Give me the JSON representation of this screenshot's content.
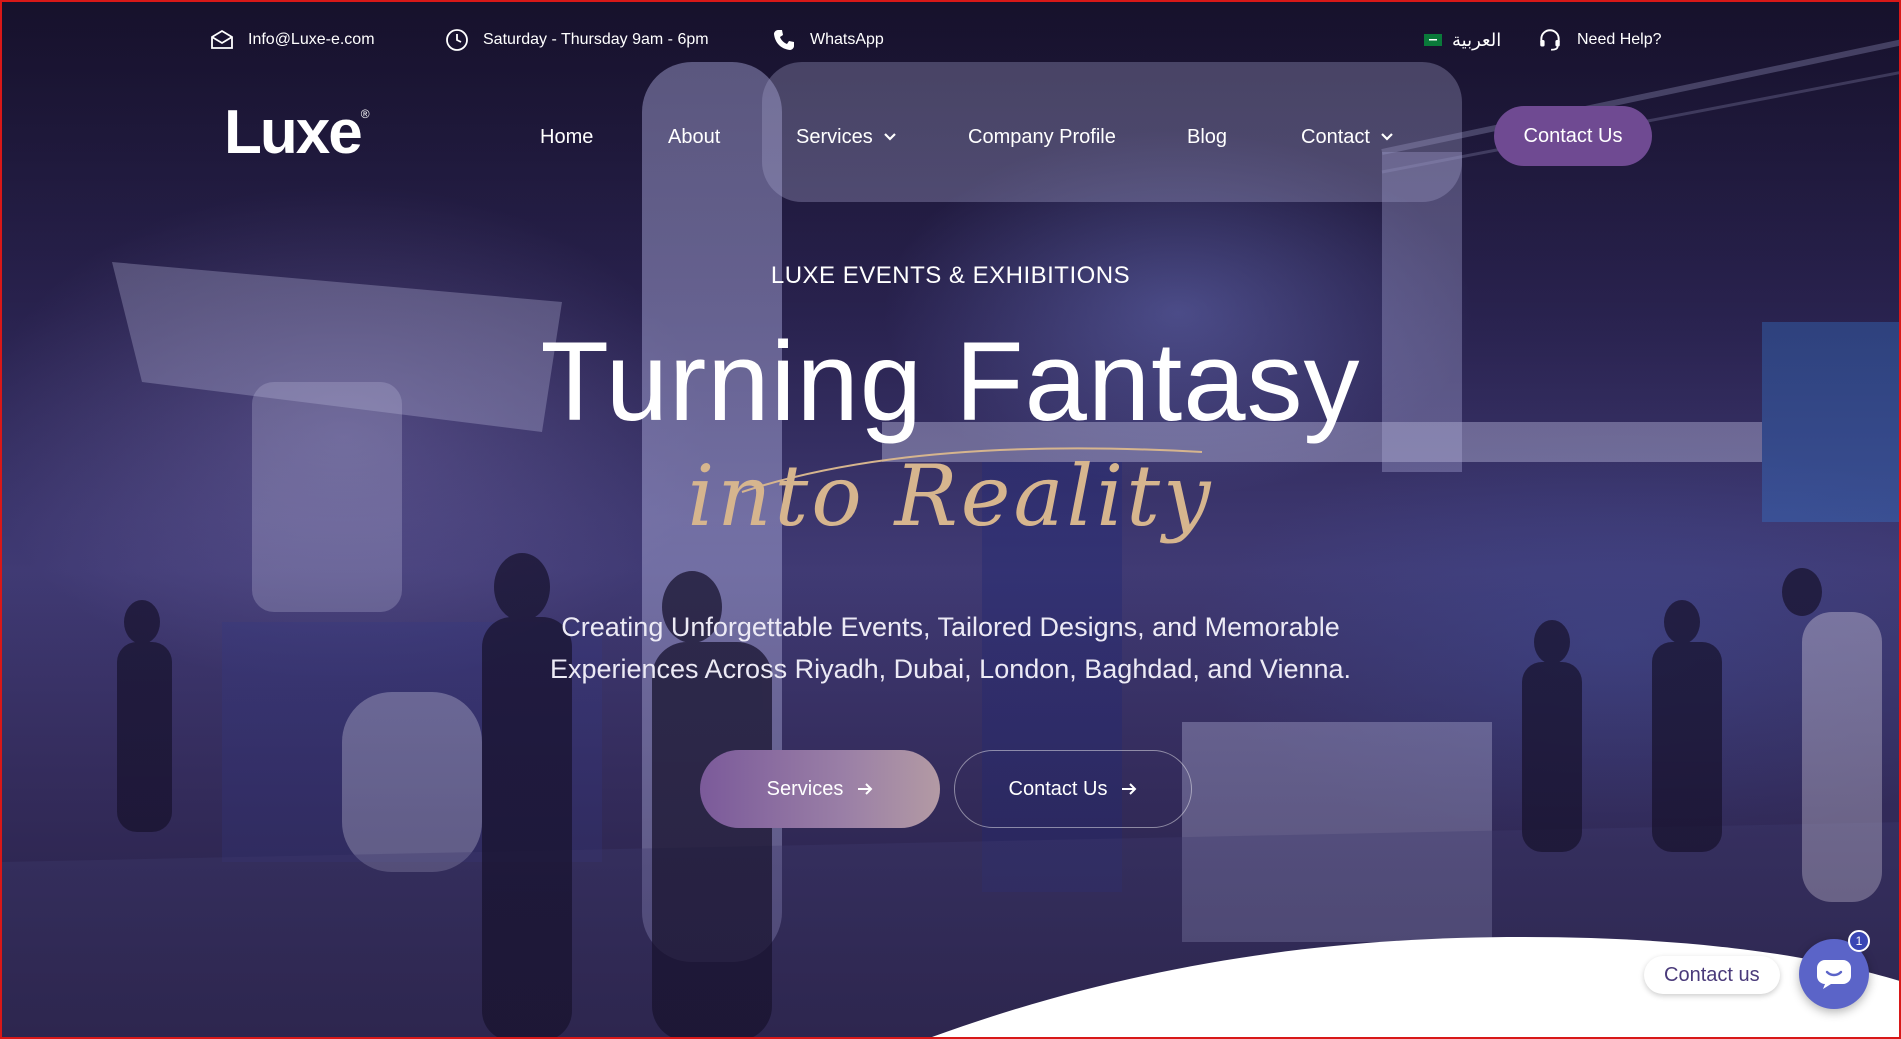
{
  "topbar": {
    "email": "Info@Luxe-e.com",
    "hours": "Saturday - Thursday 9am - 6pm",
    "whatsapp": "WhatsApp",
    "language": "العربية",
    "help": "Need Help?"
  },
  "logo": {
    "text": "Luxe",
    "mark": "®"
  },
  "nav": {
    "items": [
      {
        "label": "Home"
      },
      {
        "label": "About"
      },
      {
        "label": "Services"
      },
      {
        "label": "Company Profile"
      },
      {
        "label": "Blog"
      },
      {
        "label": "Contact"
      }
    ],
    "cta": "Contact Us"
  },
  "hero": {
    "eyebrow": "LUXE EVENTS & EXHIBITIONS",
    "headline": "Turning Fantasy",
    "script": "into Reality",
    "desc_line1": "Creating Unforgettable Events, Tailored Designs, and Memorable",
    "desc_line2": "Experiences Across Riyadh, Dubai, London, Baghdad, and Vienna.",
    "btn_primary": "Services",
    "btn_secondary": "Contact Us"
  },
  "chat": {
    "label": "Contact us",
    "badge": "1"
  },
  "colors": {
    "accent": "#6f4a92",
    "script": "#d6b58e",
    "chat": "#5b64c8"
  }
}
